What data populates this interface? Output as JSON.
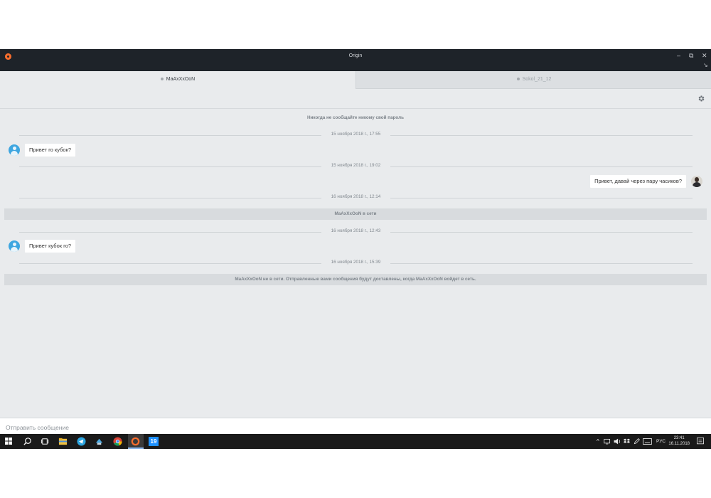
{
  "window": {
    "title": "Origin",
    "controls": {
      "minimize": "–",
      "restore": "⧉",
      "close": "✕",
      "expand": "↘"
    }
  },
  "tabs": [
    {
      "label": "MaAxXxOoN",
      "active": true
    },
    {
      "label": "Sokol_21_12",
      "active": false
    }
  ],
  "chat": {
    "security_notice": "Никогда не сообщайте никому свой пароль",
    "items": {
      "date1": "15 ноября 2018 г., 17:55",
      "msg1": "Привет го кубок?",
      "date2": "15 ноября 2018 г., 19:02",
      "msg2": "Привет, давай через пару часиков?",
      "date3": "16 ноября 2018 г., 12:14",
      "status_online": "MaAxXxOoN в сети",
      "date4": "16 ноября 2018 г., 12:43",
      "msg3": "Привет кубок го?",
      "date5": "16 ноября 2018 г., 15:39",
      "status_offline": "MaAxXxOoN не в сети. Отправленные вами сообщения будут доставлены, когда MaAxXxOoN войдет в сеть."
    }
  },
  "composer": {
    "placeholder": "Отправить сообщение",
    "value": ""
  },
  "taskbar": {
    "language": "РУС",
    "time": "23:41",
    "date": "16.11.2018",
    "badge": "19"
  },
  "colors": {
    "accent": "#f56c2d",
    "titlebar": "#1e2329",
    "chat_bg": "#e9ebed",
    "avatar_blue": "#3ea6e0"
  }
}
